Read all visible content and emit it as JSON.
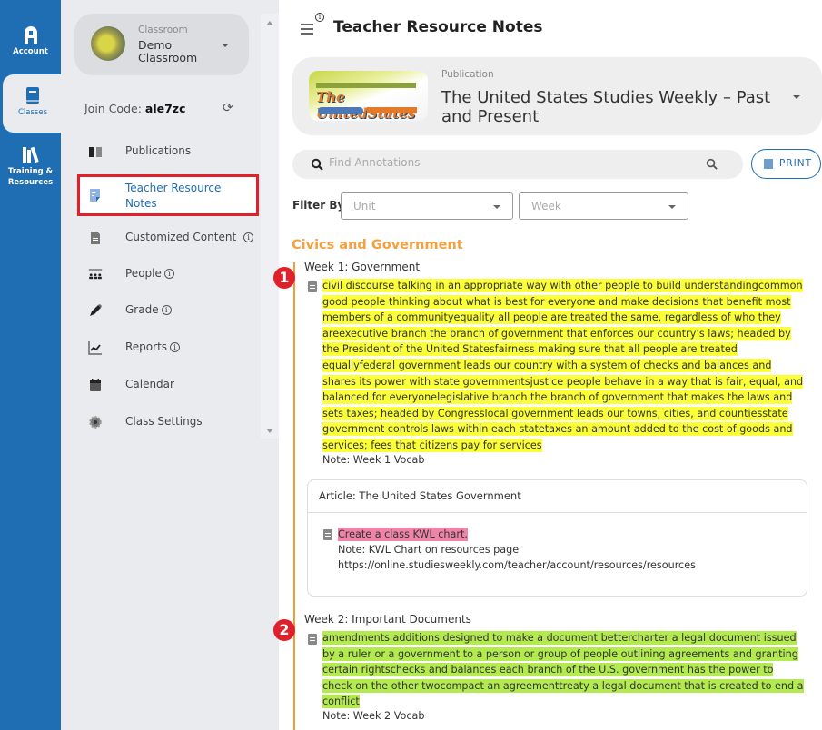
{
  "rail": {
    "items": [
      {
        "label": "Account",
        "icon": "account-icon"
      },
      {
        "label": "Classes",
        "icon": "book-icon",
        "active": true
      },
      {
        "label": "Training & Resources",
        "icon": "library-icon"
      }
    ]
  },
  "sidebar": {
    "classroom_label": "Classroom",
    "classroom_name": "Demo Classroom",
    "join_code_label": "Join Code:",
    "join_code": "ale7zc",
    "items": [
      {
        "label": "Publications",
        "icon": "book-open-icon"
      },
      {
        "label": "Teacher Resource Notes",
        "icon": "note-icon",
        "selected": true
      },
      {
        "label": "Customized Content",
        "icon": "document-icon",
        "info": true
      },
      {
        "label": "People",
        "icon": "people-icon",
        "info": true
      },
      {
        "label": "Grade",
        "icon": "pencil-icon",
        "info": true
      },
      {
        "label": "Reports",
        "icon": "chart-icon",
        "info": true
      },
      {
        "label": "Calendar",
        "icon": "calendar-icon"
      },
      {
        "label": "Class Settings",
        "icon": "gear-icon"
      }
    ],
    "info_glyph": "i"
  },
  "header": {
    "title": "Teacher Resource Notes",
    "info_glyph": "i"
  },
  "publication": {
    "label": "Publication",
    "name": "The United States Studies Weekly – Past and Present",
    "thumb_text": "The UnitedStates"
  },
  "search": {
    "placeholder": "Find Annotations",
    "value": ""
  },
  "print_label": "PRINT",
  "filter": {
    "label": "Filter By:",
    "unit_placeholder": "Unit",
    "week_placeholder": "Week"
  },
  "content": {
    "unit_title": "Civics and Government",
    "weeks": [
      {
        "badge": "1",
        "title": "Week 1: Government",
        "highlight": "civil discourse  talking in an appropriate way with other people to build understandingcommon good  people thinking about what is best for everyone and make decisions that benefit most members of a communityequality  all people are treated the same, regardless of who they areexecutive branch  the branch of government that enforces our country’s laws; headed by the President of the United Statesfairness  making sure that all people are treated equallyfederal government  leads our country with a system of checks and balances and shares its power with state governmentsjustice  people behave in a way that is fair, equal, and balanced for everyonelegislative branch  the branch of government that makes the laws and sets taxes; headed by Congresslocal government  leads our towns, cities, and countiesstate government  controls laws within each statetaxes  an amount added to the cost of goods and services; fees that citizens pay for services",
        "highlight_color": "#fbff37",
        "note": "Note: Week 1 Vocab",
        "article": {
          "title": "Article: The United States Government",
          "highlight": "Create a class KWL chart.",
          "highlight_color": "#ef84a8",
          "note_line1": "Note: KWL Chart on resources page",
          "note_line2": "https://online.studiesweekly.com/teacher/account/resources/resources"
        }
      },
      {
        "badge": "2",
        "title": "Week 2: Important Documents",
        "highlight": "amendments  additions designed to make a document bettercharter  a legal document issued by a ruler or a government to a person or group of people outlining agreements and granting certain rightschecks and balances  each branch of the U.S. government has the power to check on the other twocompact  an agreementtreaty  a legal document that is created to end a conflict",
        "highlight_color": "#b2ea50",
        "note": "Note: Week 2 Vocab"
      }
    ]
  },
  "colors": {
    "brand_blue": "#1f6db3",
    "accent_orange": "#f5a040",
    "selection_red": "#e0202a"
  }
}
